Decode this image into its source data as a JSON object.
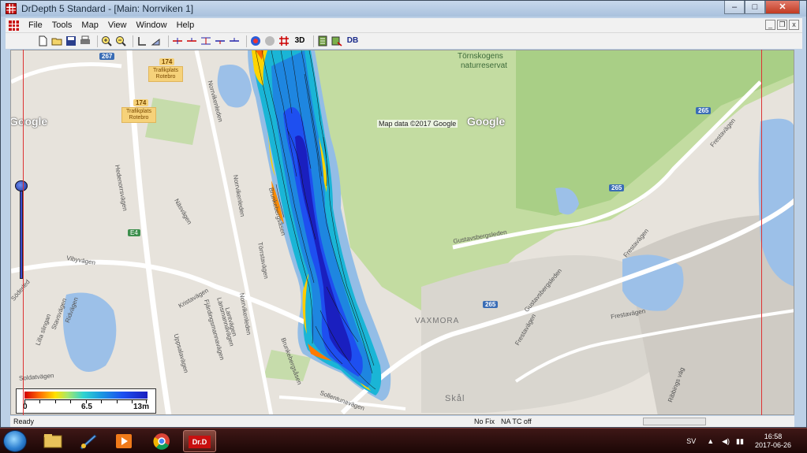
{
  "window": {
    "title": "DrDepth 5 Standard - [Main: Norrviken 1]",
    "controls": [
      "–",
      "□",
      "✕"
    ]
  },
  "menu": [
    "File",
    "Tools",
    "Map",
    "View",
    "Window",
    "Help"
  ],
  "toolbar": {
    "icons": [
      "new-icon",
      "open-icon",
      "save-icon",
      "print-icon",
      "zoom-in-icon",
      "zoom-out-icon",
      "measure-icon",
      "area-icon",
      "track-tool-1-icon",
      "track-tool-2-icon",
      "track-tool-3-icon",
      "track-tool-4-icon",
      "track-tool-5-icon",
      "color-depth-icon",
      "shade-icon",
      "grid-icon",
      "3d-icon",
      "report-icon",
      "export-icon",
      "database-icon"
    ],
    "label_3d": "3D",
    "label_db": "DB"
  },
  "map": {
    "google_logo": "Google",
    "map_data": "Map data ©2017 Google",
    "park_label_1": "Törnskogens",
    "park_label_2": "naturreservat",
    "district": "VAXMORA",
    "skal": "Skål",
    "roads": {
      "r267": "267",
      "r174": "174",
      "r265a": "265",
      "r265b": "265",
      "r265c": "265",
      "e4": "E4"
    },
    "trafik_1": "Trafikplats Rotebro",
    "trafik_2": "Trafikplats Rotebro",
    "streets": {
      "norrvikenleden_1": "Norrvikenleden",
      "norrvikenleden_2": "Norrvikenleden",
      "norrvikenleden_3": "Norrvikenleden",
      "hedenorrsvagen": "Hedenorrsvägen",
      "vibyvagen": "Vibyvägen",
      "soderled": "Söderled",
      "lilla_slingan": "Lilla slingan",
      "nasvagen": "Näsvägen",
      "kristavagen": "Kristavägen",
      "uppsalavagen": "Uppsalavägen",
      "gustavsbergsleden": "Gustavsbergsleden",
      "frestavagen_1": "Frestavägen",
      "frestavagen_2": "Frestavägen",
      "frestavagen_3": "Frestavägen",
      "frestavagen_4": "Frestavägen",
      "sollentunavagen": "Sollentunavägen",
      "brunkebergsasen": "Brunkebergsåsen",
      "brunkebergsasen_2": "Brunkebergsåsen",
      "soldatvagen": "Soldatvägen",
      "ribbings_vag": "Ribbings väg",
      "fjardingsmannsvagen": "Fjärdingsmannavägen",
      "lansmannavagen": "Länsmannavägen",
      "lantvagen": "Lantvägen",
      "gustavsbergsleden_2": "Gustavsbergsleden",
      "stavsvagen": "Stavsvägen",
      "ridvagen": "Ridvägen",
      "torrstavagen": "Törrstavägen"
    }
  },
  "legend": {
    "min": "0",
    "mid": "6.5",
    "max": "13m",
    "colors": [
      "#d40000",
      "#ff6a00",
      "#ffe100",
      "#a8e86b",
      "#2fd4d0",
      "#1a9ae0",
      "#1c4ff0",
      "#1a1fbf"
    ]
  },
  "status": {
    "ready": "Ready",
    "fix": "No Fix",
    "tc": "NA  TC off"
  },
  "taskbar": {
    "apps": [
      "explorer-icon",
      "drdepth-alt-icon",
      "media-player-icon",
      "chrome-icon",
      "drdepth-icon"
    ],
    "drdepth_label": "Dr.D",
    "lang": "SV",
    "time": "16:58",
    "date": "2017-06-26"
  }
}
